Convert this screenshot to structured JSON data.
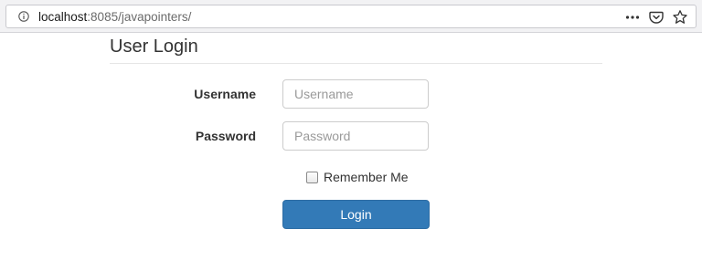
{
  "browser": {
    "url_host": "localhost",
    "url_path": ":8085/javapointers/",
    "icons": [
      "info-icon",
      "more-icon",
      "pocket-icon",
      "bookmark-star-icon"
    ]
  },
  "page": {
    "title": "User Login",
    "form": {
      "username": {
        "label": "Username",
        "placeholder": "Username",
        "value": ""
      },
      "password": {
        "label": "Password",
        "placeholder": "Password",
        "value": ""
      },
      "remember_me": {
        "label": "Remember Me",
        "checked": false
      },
      "submit_label": "Login"
    },
    "colors": {
      "primary_button": "#337ab7"
    }
  }
}
